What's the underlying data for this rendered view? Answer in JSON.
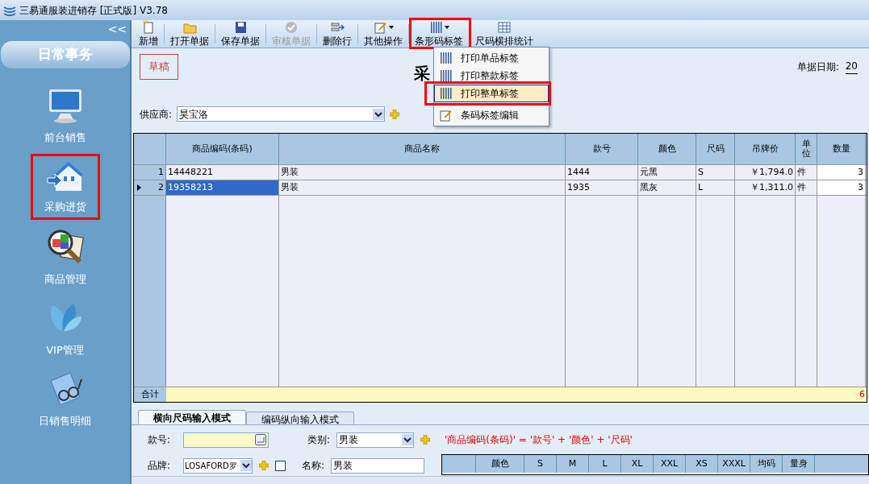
{
  "window": {
    "title": "三易通服装进销存 [正式版] V3.78"
  },
  "sidebar": {
    "collapse": "<<",
    "section": "日常事务",
    "items": [
      {
        "label": "前台销售",
        "annotated": false
      },
      {
        "label": "采购进货",
        "annotated": true
      },
      {
        "label": "商品管理",
        "annotated": false
      },
      {
        "label": "VIP管理",
        "annotated": false
      },
      {
        "label": "日销售明细",
        "annotated": false
      }
    ]
  },
  "toolbar": [
    {
      "label": "新增",
      "kind": "button",
      "disabled": false,
      "annotated": false
    },
    {
      "label": "打开单据",
      "kind": "button",
      "disabled": false,
      "annotated": false
    },
    {
      "label": "保存单据",
      "kind": "button",
      "disabled": false,
      "annotated": false
    },
    {
      "label": "审核单据",
      "kind": "button",
      "disabled": true,
      "annotated": false
    },
    {
      "label": "删除行",
      "kind": "button",
      "disabled": false,
      "annotated": false
    },
    {
      "label": "其他操作",
      "kind": "dropdown",
      "disabled": false,
      "annotated": false
    },
    {
      "label": "条形码标签",
      "kind": "dropdown",
      "disabled": false,
      "annotated": true
    },
    {
      "label": "尺码横排统计",
      "kind": "button",
      "disabled": false,
      "annotated": false
    }
  ],
  "menu": {
    "items": [
      {
        "label": "打印单品标签",
        "selected": false,
        "annotated": false
      },
      {
        "label": "打印整款标签",
        "selected": false,
        "annotated": false
      },
      {
        "label": "打印整单标签",
        "selected": true,
        "annotated": true
      },
      {
        "label": "条码标签编辑",
        "selected": false,
        "annotated": false
      }
    ]
  },
  "document": {
    "status": "草稿",
    "title": "采",
    "date_label": "单据日期:",
    "date_value": "20",
    "supplier_label": "供应商:",
    "supplier_value": "昊宝洛"
  },
  "table": {
    "columns": [
      "商品编码(条码)",
      "商品名称",
      "款号",
      "颜色",
      "尺码",
      "吊牌价",
      "单位",
      "数量"
    ],
    "rows": [
      {
        "index": "1",
        "current": false,
        "cells": [
          "14448221",
          "男装",
          "1444",
          "元黑",
          "S",
          "￥1,794.0",
          "件",
          "3"
        ]
      },
      {
        "index": "2",
        "current": true,
        "cells": [
          "19358213",
          "男装",
          "1935",
          "黑灰",
          "L",
          "￥1,311.0",
          "件",
          "3"
        ]
      }
    ],
    "total_label": "合计",
    "total_qty": "6"
  },
  "bottom_tabs": [
    {
      "label": "横向尺码输入模式",
      "selected": true
    },
    {
      "label": "编码纵向输入模式",
      "selected": false
    }
  ],
  "form": {
    "style_label": "款号:",
    "category_label": "类别:",
    "category_value": "男装",
    "brand_label": "品牌:",
    "brand_value": "LOSAFORD罗",
    "checked": false,
    "name_label": "名称:",
    "name_value": "男装",
    "formula": "'商品编码(条码)' = '款号' + '颜色' + '尺码'"
  },
  "size_grid": {
    "columns": [
      "颜色",
      "S",
      "M",
      "L",
      "XL",
      "XXL",
      "XS",
      "XXXL",
      "均码",
      "量身"
    ]
  }
}
